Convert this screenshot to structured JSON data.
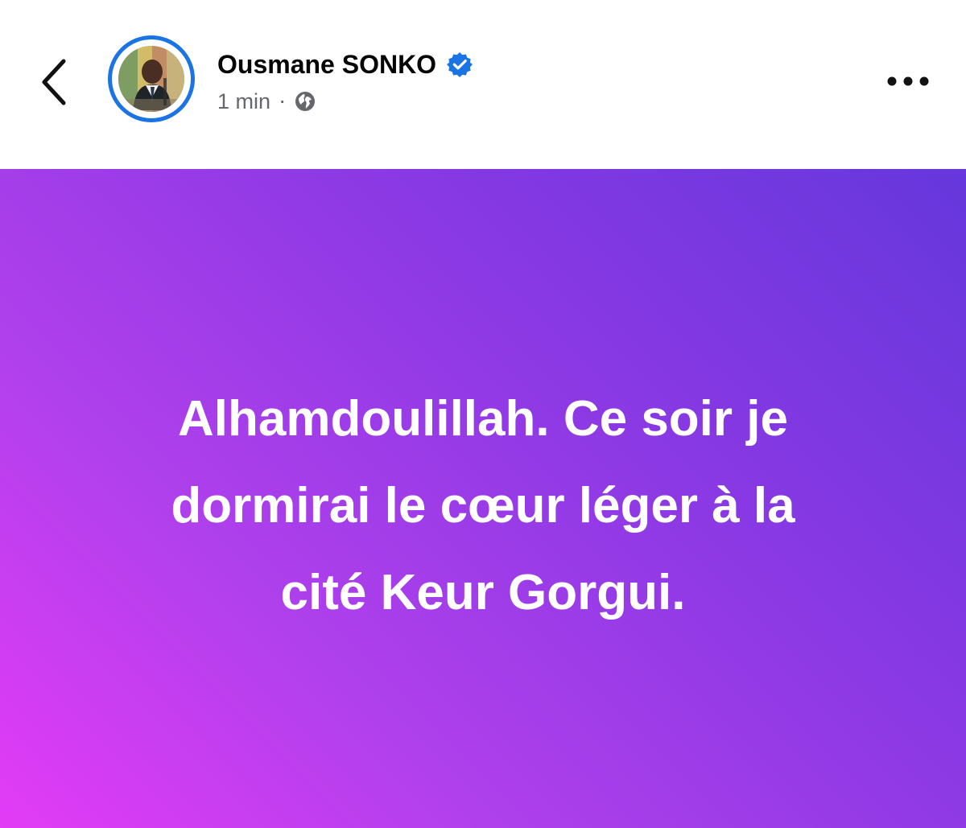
{
  "header": {
    "author_name": "Ousmane SONKO",
    "timestamp": "1 min",
    "separator": "·",
    "icons": {
      "back": "back-chevron-icon",
      "verified": "verified-badge-icon",
      "audience": "globe-icon",
      "more": "more-options-icon"
    }
  },
  "post": {
    "text": "Alhamdoulillah. Ce soir je\ndormirai le cœur léger à la\ncité Keur Gorgui."
  },
  "colors": {
    "verified_blue": "#1b74e4",
    "secondary_text": "#65676b",
    "post_gradient_start": "#6537dc",
    "post_gradient_mid": "#8c39e4",
    "post_gradient_end": "#e33bf6"
  }
}
